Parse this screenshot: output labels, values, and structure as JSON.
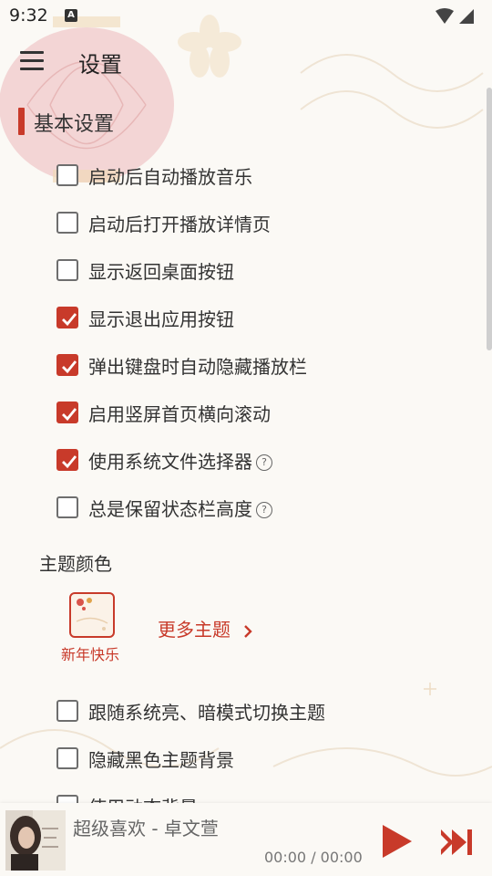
{
  "status_bar": {
    "time": "9:32",
    "notification_icon": "A"
  },
  "app_bar": {
    "title": "设置",
    "menu_icon": "hamburger-menu-icon"
  },
  "section": {
    "title": "基本设置"
  },
  "settings": [
    {
      "label": "启动后自动播放音乐",
      "checked": false,
      "help": false
    },
    {
      "label": "启动后打开播放详情页",
      "checked": false,
      "help": false
    },
    {
      "label": "显示返回桌面按钮",
      "checked": false,
      "help": false
    },
    {
      "label": "显示退出应用按钮",
      "checked": true,
      "help": false
    },
    {
      "label": "弹出键盘时自动隐藏播放栏",
      "checked": true,
      "help": false
    },
    {
      "label": "启用竖屏首页横向滚动",
      "checked": true,
      "help": false
    },
    {
      "label": "使用系统文件选择器",
      "checked": true,
      "help": true
    },
    {
      "label": "总是保留状态栏高度",
      "checked": false,
      "help": true
    }
  ],
  "theme": {
    "label": "主题颜色",
    "current_name": "新年快乐",
    "more_label": "更多主题",
    "help_glyph": "?"
  },
  "settings_after": [
    {
      "label": "跟随系统亮、暗模式切换主题",
      "checked": false
    },
    {
      "label": "隐藏黑色主题背景",
      "checked": false
    },
    {
      "label": "使用动态背景",
      "checked": false
    }
  ],
  "player": {
    "track": "超级喜欢 - 卓文萱",
    "time": "00:00 / 00:00"
  },
  "colors": {
    "accent": "#c83a2a",
    "background": "#fbf9f5",
    "text": "#333333"
  }
}
